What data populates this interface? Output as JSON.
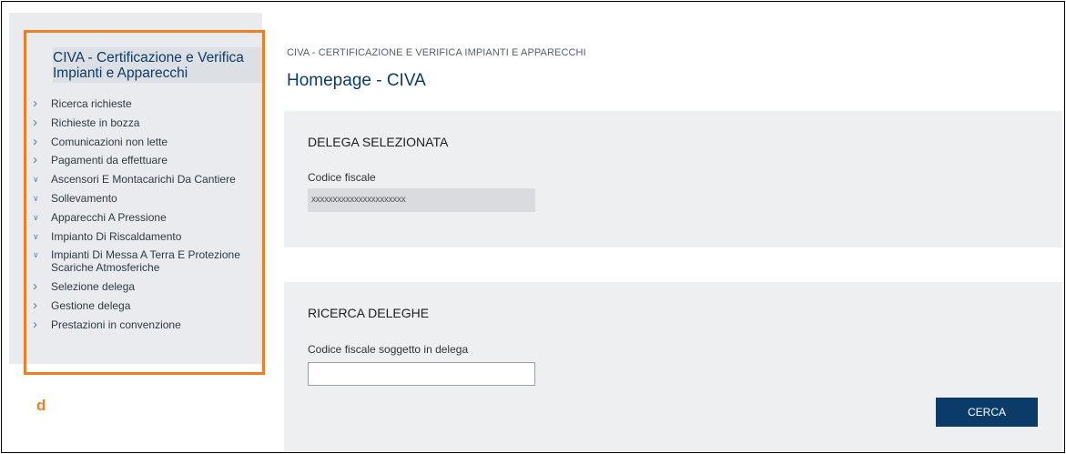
{
  "sidebar": {
    "title_line1": "CIVA - Certificazione e Verifica",
    "title_line2": "Impianti e Apparecchi",
    "items": [
      {
        "label": "Ricerca richieste",
        "icon": "chevron-right-icon"
      },
      {
        "label": "Richieste in bozza",
        "icon": "chevron-right-icon"
      },
      {
        "label": "Comunicazioni non lette",
        "icon": "chevron-right-icon"
      },
      {
        "label": "Pagamenti da effettuare",
        "icon": "chevron-right-icon"
      },
      {
        "label": "Ascensori E Montacarichi Da Cantiere",
        "icon": "chevron-down-icon"
      },
      {
        "label": "Sollevamento",
        "icon": "chevron-down-icon"
      },
      {
        "label": "Apparecchi A Pressione",
        "icon": "chevron-down-icon"
      },
      {
        "label": "Impianto Di Riscaldamento",
        "icon": "chevron-down-icon"
      },
      {
        "label": "Impianti Di Messa A Terra E Protezione Scariche Atmosferiche",
        "icon": "chevron-down-icon"
      },
      {
        "label": "Selezione delega",
        "icon": "chevron-right-icon"
      },
      {
        "label": "Gestione delega",
        "icon": "chevron-right-icon"
      },
      {
        "label": "Prestazioni in convenzione",
        "icon": "chevron-right-icon"
      }
    ]
  },
  "annotation_label": "d",
  "breadcrumb": "CIVA - CERTIFICAZIONE E VERIFICA IMPIANTI E APPARECCHI",
  "page_title": "Homepage - CIVA",
  "delega_selezionata": {
    "title": "DELEGA SELEZIONATA",
    "field_label": "Codice fiscale",
    "field_value": "xxxxxxxxxxxxxxxxxxxxxx"
  },
  "ricerca_deleghe": {
    "title": "RICERCA DELEGHE",
    "field_label": "Codice fiscale soggetto in delega",
    "field_value": "",
    "button_label": "CERCA"
  },
  "colors": {
    "accent_orange": "#f07d22",
    "brand_blue": "#0b3c69"
  }
}
